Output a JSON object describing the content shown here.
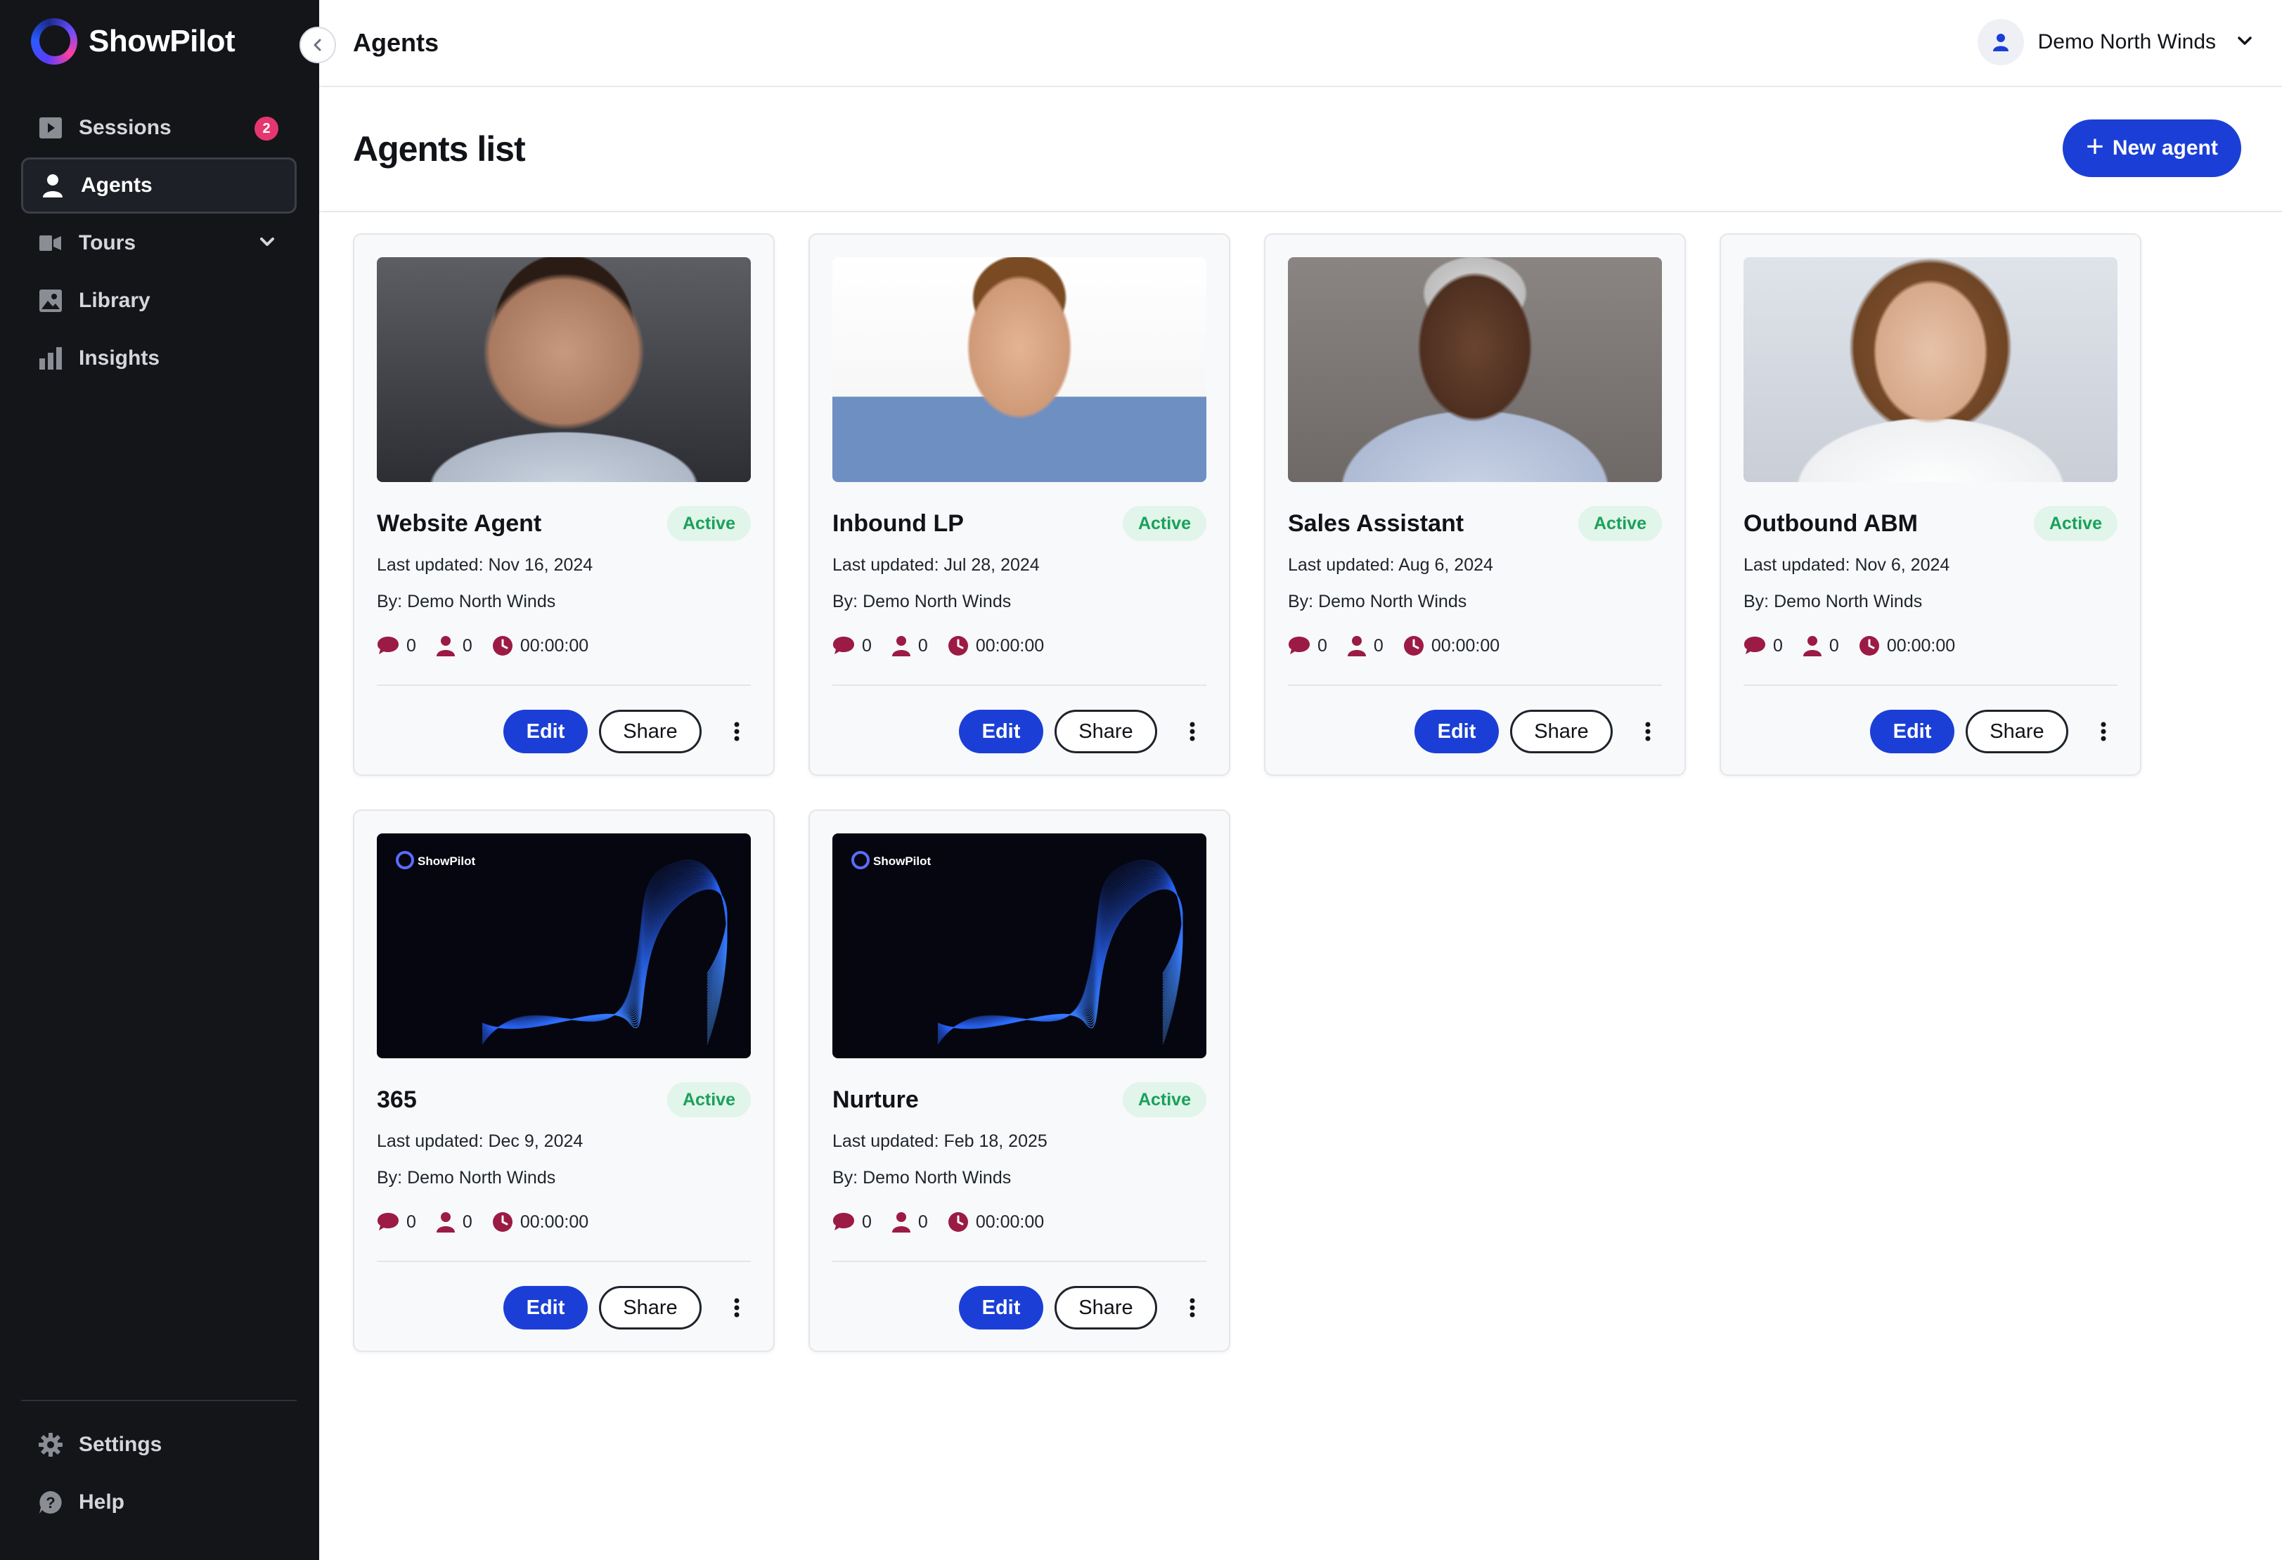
{
  "sidebar": {
    "brand": "ShowPilot",
    "items": [
      {
        "label": "Sessions",
        "badge": "2",
        "icon": "play-icon"
      },
      {
        "label": "Agents",
        "icon": "person-icon",
        "active": true
      },
      {
        "label": "Tours",
        "icon": "tours-icon",
        "expandable": true
      },
      {
        "label": "Library",
        "icon": "image-icon"
      },
      {
        "label": "Insights",
        "icon": "bar-chart-icon"
      }
    ],
    "bottom_items": [
      {
        "label": "Settings",
        "icon": "gear-icon"
      },
      {
        "label": "Help",
        "icon": "help-icon"
      }
    ]
  },
  "header": {
    "title": "Agents",
    "user_name": "Demo North Winds"
  },
  "page": {
    "title": "Agents list",
    "new_agent_label": "New agent"
  },
  "agents": [
    {
      "name": "Website Agent",
      "status": "Active",
      "updated": "Last updated: Nov 16, 2024",
      "by": "By: Demo North Winds",
      "messages": "0",
      "users": "0",
      "duration": "00:00:00",
      "image": "woman-grey-blazer-photo"
    },
    {
      "name": "Inbound LP",
      "status": "Active",
      "updated": "Last updated: Jul 28, 2024",
      "by": "By: Demo North Winds",
      "messages": "0",
      "users": "0",
      "duration": "00:00:00",
      "image": "man-suit-photo"
    },
    {
      "name": "Sales Assistant",
      "status": "Active",
      "updated": "Last updated: Aug 6, 2024",
      "by": "By: Demo North Winds",
      "messages": "0",
      "users": "0",
      "duration": "00:00:00",
      "image": "woman-turtleneck-photo"
    },
    {
      "name": "Outbound ABM",
      "status": "Active",
      "updated": "Last updated: Nov 6, 2024",
      "by": "By: Demo North Winds",
      "messages": "0",
      "users": "0",
      "duration": "00:00:00",
      "image": "woman-white-shirt-photo"
    },
    {
      "name": "365",
      "status": "Active",
      "updated": "Last updated: Dec 9, 2024",
      "by": "By: Demo North Winds",
      "messages": "0",
      "users": "0",
      "duration": "00:00:00",
      "image": "showpilot-wave-thumbnail"
    },
    {
      "name": "Nurture",
      "status": "Active",
      "updated": "Last updated: Feb 18, 2025",
      "by": "By: Demo North Winds",
      "messages": "0",
      "users": "0",
      "duration": "00:00:00",
      "image": "showpilot-wave-thumbnail"
    }
  ],
  "card_actions": {
    "edit_label": "Edit",
    "share_label": "Share"
  },
  "thumbnail_brand": "ShowPilot",
  "colors": {
    "sidebar_bg": "#131519",
    "accent": "#1b3fd6",
    "badge": "#e5366f",
    "status_bg": "#e1f5ea",
    "status_text": "#1aa15a",
    "stat_icon": "#9b1b45"
  }
}
